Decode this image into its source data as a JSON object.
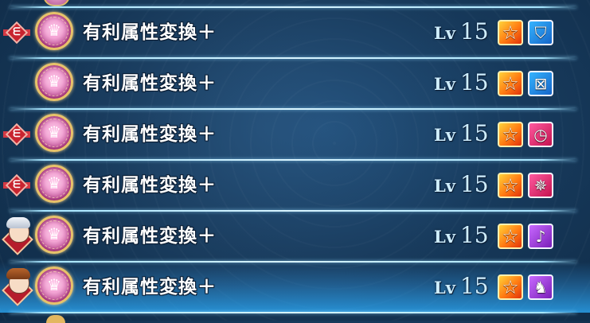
{
  "rows": [
    {
      "skill_name": "有利属性変換＋",
      "level_label": "Lv",
      "level_value": "15",
      "left": "emblem",
      "skill_icon": "crown-icon",
      "type_icon": "shield-icon",
      "type_color": "#1f8fe0",
      "selected": false
    },
    {
      "skill_name": "有利属性変換＋",
      "level_label": "Lv",
      "level_value": "15",
      "left": "none",
      "skill_icon": "crown-icon",
      "type_icon": "crossed-swords-icon",
      "type_color": "#1f8fe0",
      "selected": false
    },
    {
      "skill_name": "有利属性変換＋",
      "level_label": "Lv",
      "level_value": "15",
      "left": "emblem",
      "skill_icon": "crown-icon",
      "type_icon": "timer-icon",
      "type_color": "#e0236a",
      "selected": false
    },
    {
      "skill_name": "有利属性変換＋",
      "level_label": "Lv",
      "level_value": "15",
      "left": "emblem",
      "skill_icon": "crown-icon",
      "type_icon": "compass-icon",
      "type_color": "#e0236a",
      "selected": false
    },
    {
      "skill_name": "有利属性変換＋",
      "level_label": "Lv",
      "level_value": "15",
      "left": "portrait-silver",
      "skill_icon": "crown-icon",
      "type_icon": "horn-icon",
      "type_color": "#a63bd6",
      "selected": false
    },
    {
      "skill_name": "有利属性変換＋",
      "level_label": "Lv",
      "level_value": "15",
      "left": "portrait-brown",
      "skill_icon": "crown-icon",
      "type_icon": "cat-down-icon",
      "type_color": "#a63bd6",
      "selected": true
    }
  ],
  "colors": {
    "accent": "#a7e6ff",
    "star_badge": "#ff7a12",
    "selected_row": "#2daeff"
  }
}
